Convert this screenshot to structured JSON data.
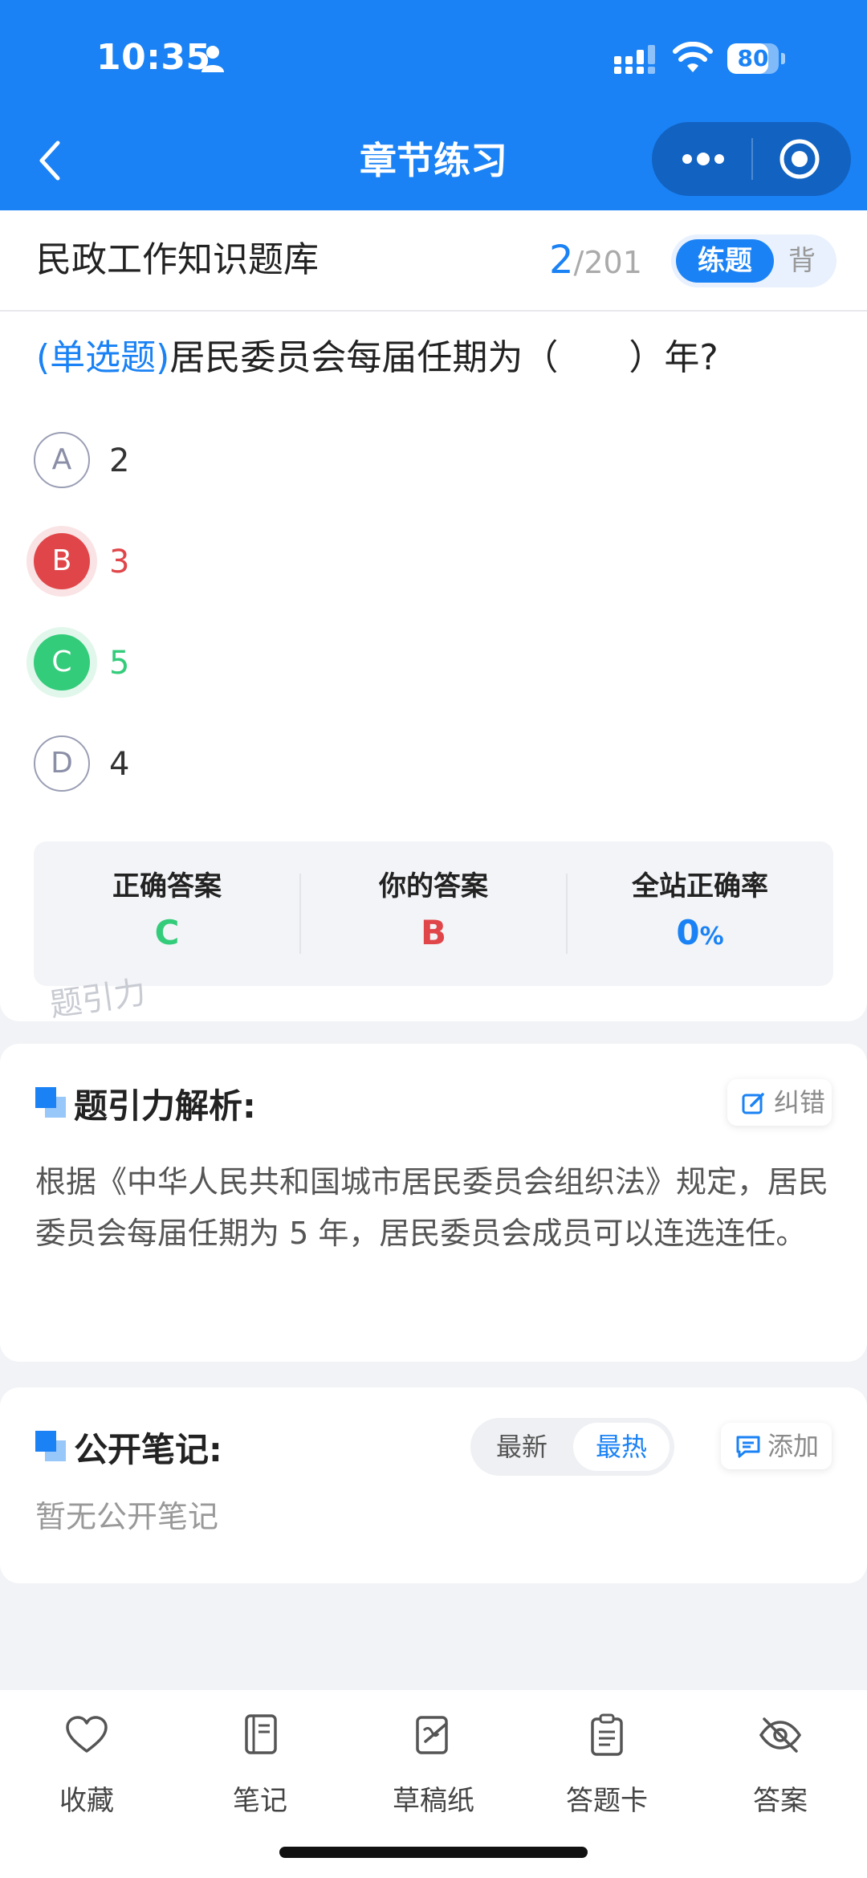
{
  "status_bar": {
    "time": "10:35",
    "battery": "80",
    "battery_level": 0.8
  },
  "nav": {
    "title": "章节练习",
    "icons": [
      "back-icon",
      "more-icon",
      "target-icon"
    ]
  },
  "header": {
    "bank_name": "民政工作知识题库",
    "current": "2",
    "separator": "/",
    "total": "201",
    "mode_active": "练题",
    "mode_inactive": "背"
  },
  "question": {
    "type": "(单选题)",
    "stem": "居民委员会每届任期为（　　）年?",
    "options": [
      {
        "letter": "A",
        "text": "2",
        "state": "normal"
      },
      {
        "letter": "B",
        "text": "3",
        "state": "wrong"
      },
      {
        "letter": "C",
        "text": "5",
        "state": "correct"
      },
      {
        "letter": "D",
        "text": "4",
        "state": "normal"
      }
    ]
  },
  "stats": {
    "correct_label": "正确答案",
    "correct_value": "C",
    "yours_label": "你的答案",
    "yours_value": "B",
    "rate_label": "全站正确率",
    "rate_value": "0",
    "rate_unit": "%"
  },
  "watermark": "题引力",
  "analysis": {
    "title": "题引力解析:",
    "report_button": "纠错",
    "text": "根据《中华人民共和国城市居民委员会组织法》规定，居民委员会每届任期为 5 年，居民委员会成员可以连选连任。"
  },
  "notes": {
    "title": "公开笔记:",
    "sort_newest": "最新",
    "sort_hot": "最热",
    "add_button": "添加",
    "empty_text": "暂无公开笔记"
  },
  "tabbar": {
    "items": [
      {
        "label": "收藏",
        "icon": "heart-icon"
      },
      {
        "label": "笔记",
        "icon": "notebook-icon"
      },
      {
        "label": "草稿纸",
        "icon": "draft-icon"
      },
      {
        "label": "答题卡",
        "icon": "clipboard-icon"
      },
      {
        "label": "答案",
        "icon": "eye-off-icon"
      }
    ]
  },
  "colors": {
    "brand": "#1a82f5",
    "wrong": "#e04649",
    "correct": "#33cc7a"
  }
}
